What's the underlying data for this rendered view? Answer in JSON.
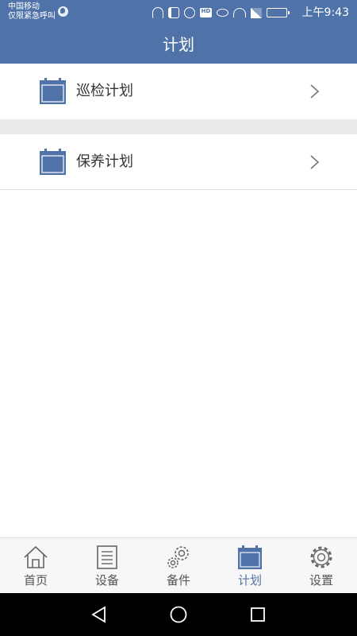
{
  "status_bar": {
    "carrier_line1": "中国移动",
    "carrier_line2": "仅限紧急呼叫",
    "hd_badge": "HD",
    "time": "上午9:43",
    "icons": [
      "globe-icon",
      "headset-icon",
      "mute-icon",
      "alarm-icon",
      "hd-icon",
      "eye-icon",
      "wifi-icon",
      "signal-icon",
      "battery-icon"
    ]
  },
  "header": {
    "title": "计划"
  },
  "plan_list": {
    "items": [
      {
        "label": "巡检计划",
        "icon": "calendar-icon"
      },
      {
        "label": "保养计划",
        "icon": "calendar-icon"
      }
    ]
  },
  "tab_bar": {
    "active": "计划",
    "tabs": [
      {
        "label": "首页",
        "icon": "home-icon"
      },
      {
        "label": "设备",
        "icon": "device-list-icon"
      },
      {
        "label": "备件",
        "icon": "gears-icon"
      },
      {
        "label": "计划",
        "icon": "calendar-icon"
      },
      {
        "label": "设置",
        "icon": "settings-icon"
      }
    ]
  },
  "nav_bar": {
    "buttons": [
      "back-icon",
      "home-circle-icon",
      "recents-icon"
    ]
  },
  "colors": {
    "primary": "#4f73a8",
    "divider": "#ebebeb",
    "text": "#333333",
    "tab_inactive": "#555555"
  }
}
